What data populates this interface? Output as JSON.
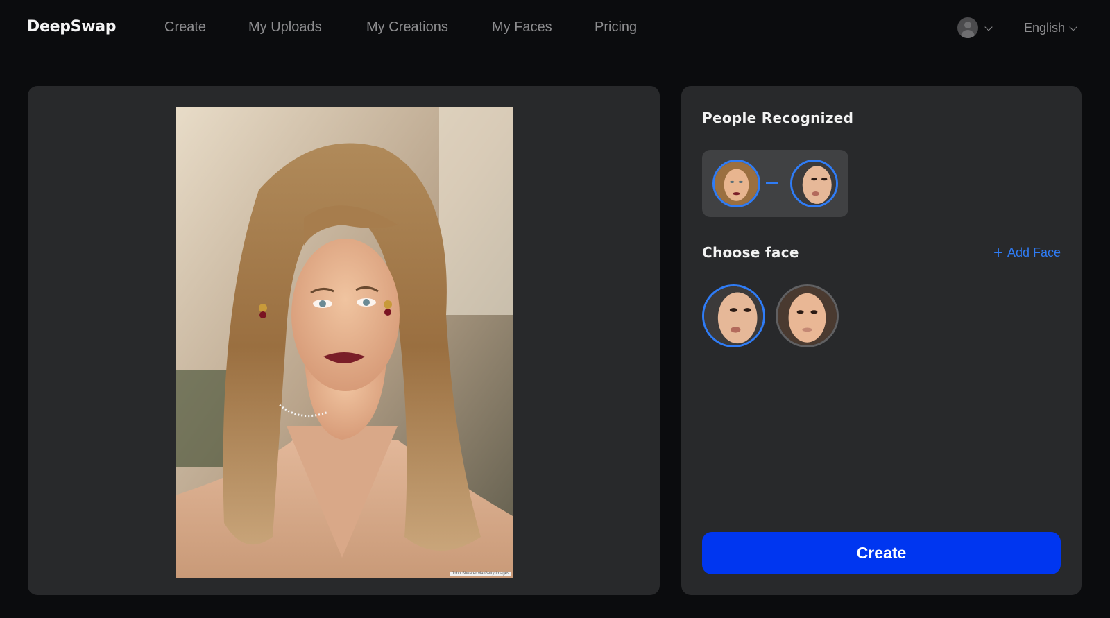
{
  "header": {
    "logo": "DeepSwap",
    "nav": [
      {
        "label": "Create"
      },
      {
        "label": "My Uploads"
      },
      {
        "label": "My Creations"
      },
      {
        "label": "My Faces"
      },
      {
        "label": "Pricing"
      }
    ],
    "account_icon": "user-avatar-icon",
    "language": "English"
  },
  "preview": {
    "image_alt": "Uploaded photo of a woman with long wavy blonde hair",
    "credit": "John Shearer via Getty Images"
  },
  "sidebar": {
    "people_recognized_title": "People Recognized",
    "mapping": {
      "source_face": "recognized-face",
      "target_face": "selected-face",
      "arrow_icon": "arrow-right-icon"
    },
    "choose_face_title": "Choose face",
    "add_face_label": "Add Face",
    "faces": [
      {
        "name": "face-1",
        "selected": true
      },
      {
        "name": "face-2",
        "selected": false
      }
    ],
    "create_label": "Create"
  },
  "colors": {
    "accent": "#2f7cf6",
    "primary_button": "#0036f0",
    "panel": "#28292b",
    "background": "#0b0c0e"
  }
}
